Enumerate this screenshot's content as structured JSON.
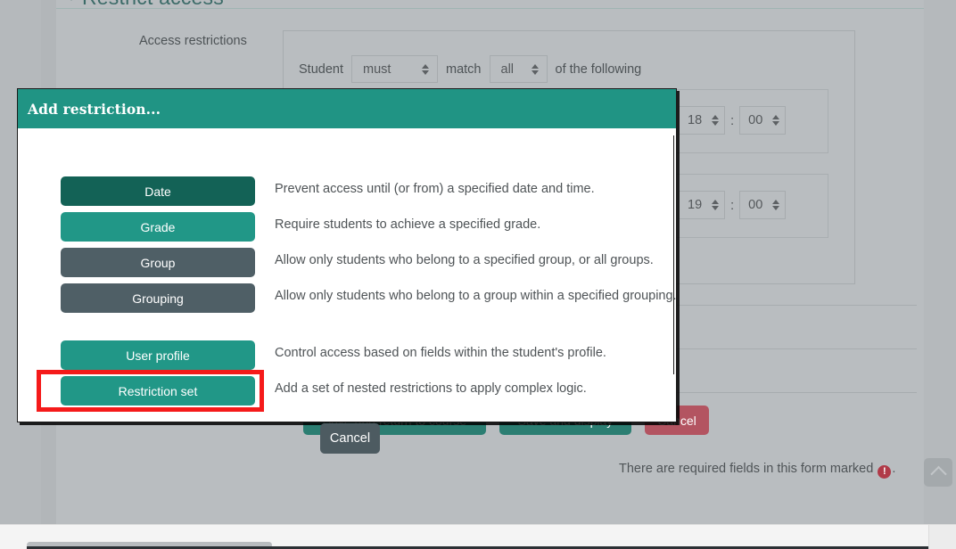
{
  "background": {
    "section_heading": "Restrict access",
    "field_label": "Access restrictions",
    "condition_prefix": "Student",
    "condition_operator": "must",
    "condition_middle": "match",
    "condition_quantifier": "all",
    "condition_suffix": "of the following",
    "rows": [
      {
        "hour": "18",
        "minute": "00",
        "colon": ":",
        "remove_label": "×"
      },
      {
        "hour": "19",
        "minute": "00",
        "colon": ":",
        "remove_label": "×"
      }
    ],
    "buttons": {
      "save_return": "Save and return to course",
      "save_display": "Save and display",
      "cancel": "Cancel"
    },
    "required_note_before": "There are required fields in this form marked",
    "required_icon_glyph": "!",
    "required_note_after": ".",
    "to_top_label": "Back to top"
  },
  "modal": {
    "title": "Add restriction...",
    "cancel_label": "Cancel",
    "options": [
      {
        "label": "Date",
        "description": "Prevent access until (or from) a specified date and time.",
        "color": "#136256",
        "highlighted": false
      },
      {
        "label": "Grade",
        "description": "Require students to achieve a specified grade.",
        "color": "#219787",
        "highlighted": false
      },
      {
        "label": "Group",
        "description": "Allow only students who belong to a specified group, or all groups.",
        "color": "#4f5f66",
        "highlighted": false
      },
      {
        "label": "Grouping",
        "description": "Allow only students who belong to a group within a specified grouping.",
        "color": "#4f5f66",
        "highlighted": false
      },
      {
        "label": "User profile",
        "description": "Control access based on fields within the student's profile.",
        "color": "#219787",
        "highlighted": false
      },
      {
        "label": "Restriction set",
        "description": "Add a set of nested restrictions to apply complex logic.",
        "color": "#219787",
        "highlighted": true
      }
    ]
  },
  "theme": {
    "accent": "#209484",
    "accent_dark": "#136256",
    "slate": "#4f5f66",
    "danger": "#b35461",
    "highlight": "#f51a1a",
    "page_bg": "#b9bdc0"
  }
}
